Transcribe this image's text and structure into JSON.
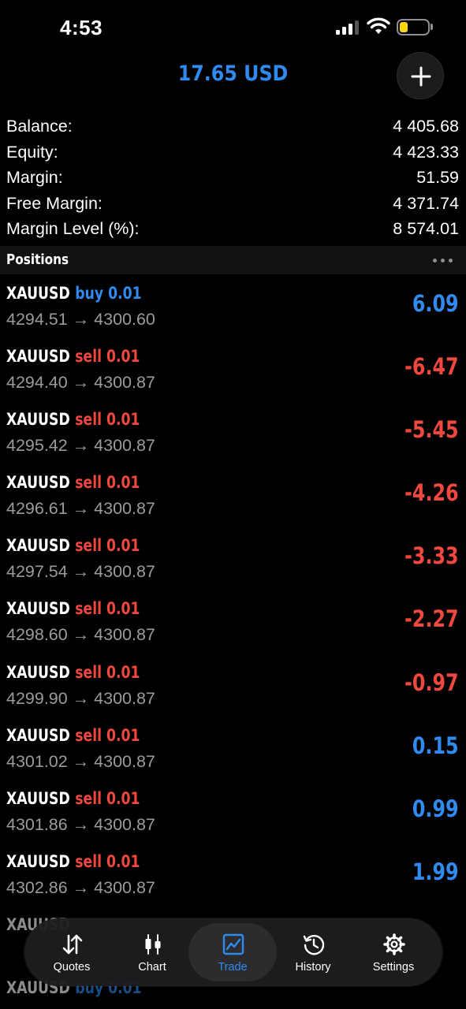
{
  "status_bar": {
    "time": "4:53"
  },
  "header": {
    "total": "17.65 USD"
  },
  "account": [
    {
      "label": "Balance:",
      "value": "4 405.68"
    },
    {
      "label": "Equity:",
      "value": "4 423.33"
    },
    {
      "label": "Margin:",
      "value": "51.59"
    },
    {
      "label": "Free Margin:",
      "value": "4 371.74"
    },
    {
      "label": "Margin Level (%):",
      "value": "8 574.01"
    }
  ],
  "positions_section": {
    "title": "Positions"
  },
  "positions": [
    {
      "symbol": "XAUUSD",
      "side": "buy 0.01",
      "prices": "4294.51 → 4300.60",
      "profit": "6.09",
      "side_color": "#2f8bf0",
      "profit_color": "#2f8bf0"
    },
    {
      "symbol": "XAUUSD",
      "side": "sell 0.01",
      "prices": "4294.40 → 4300.87",
      "profit": "-6.47",
      "side_color": "#f0483e",
      "profit_color": "#f0483e"
    },
    {
      "symbol": "XAUUSD",
      "side": "sell 0.01",
      "prices": "4295.42 → 4300.87",
      "profit": "-5.45",
      "side_color": "#f0483e",
      "profit_color": "#f0483e"
    },
    {
      "symbol": "XAUUSD",
      "side": "sell 0.01",
      "prices": "4296.61 → 4300.87",
      "profit": "-4.26",
      "side_color": "#f0483e",
      "profit_color": "#f0483e"
    },
    {
      "symbol": "XAUUSD",
      "side": "sell 0.01",
      "prices": "4297.54 → 4300.87",
      "profit": "-3.33",
      "side_color": "#f0483e",
      "profit_color": "#f0483e"
    },
    {
      "symbol": "XAUUSD",
      "side": "sell 0.01",
      "prices": "4298.60 → 4300.87",
      "profit": "-2.27",
      "side_color": "#f0483e",
      "profit_color": "#f0483e"
    },
    {
      "symbol": "XAUUSD",
      "side": "sell 0.01",
      "prices": "4299.90 → 4300.87",
      "profit": "-0.97",
      "side_color": "#f0483e",
      "profit_color": "#f0483e"
    },
    {
      "symbol": "XAUUSD",
      "side": "sell 0.01",
      "prices": "4301.02 → 4300.87",
      "profit": "0.15",
      "side_color": "#f0483e",
      "profit_color": "#2f8bf0"
    },
    {
      "symbol": "XAUUSD",
      "side": "sell 0.01",
      "prices": "4301.86 → 4300.87",
      "profit": "0.99",
      "side_color": "#f0483e",
      "profit_color": "#2f8bf0"
    },
    {
      "symbol": "XAUUSD",
      "side": "sell 0.01",
      "prices": "4302.86 → 4300.87",
      "profit": "1.99",
      "side_color": "#f0483e",
      "profit_color": "#2f8bf0"
    },
    {
      "symbol": "XAUUSD",
      "side": "",
      "prices": "",
      "profit": "",
      "side_color": "#2f8bf0",
      "profit_color": "#2f8bf0"
    },
    {
      "symbol": "XAUUSD",
      "side": "buy 0.01",
      "prices": "",
      "profit": "",
      "side_color": "#2f8bf0",
      "profit_color": "#2f8bf0"
    }
  ],
  "tab_bar": {
    "tabs": [
      {
        "label": "Quotes",
        "icon": "quotes-arrows-icon"
      },
      {
        "label": "Chart",
        "icon": "candlestick-icon"
      },
      {
        "label": "Trade",
        "icon": "trend-chart-icon",
        "active": true
      },
      {
        "label": "History",
        "icon": "history-clock-icon"
      },
      {
        "label": "Settings",
        "icon": "gear-icon"
      }
    ]
  },
  "colors": {
    "accent": "#2f8bf0",
    "loss": "#f0483e",
    "background": "#000000",
    "battery": "#ffd60a"
  }
}
